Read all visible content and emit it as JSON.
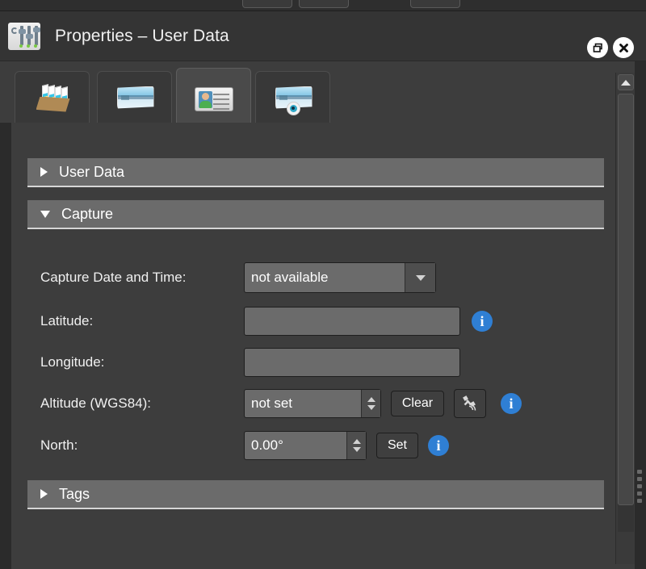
{
  "window": {
    "title": "Properties – User Data",
    "app_icon": "sliders-icon",
    "restore_label": "restore-window",
    "close_label": "close-window"
  },
  "tabs": [
    {
      "name": "tab-images",
      "icon": "image-box-icon",
      "active": false
    },
    {
      "name": "tab-panorama",
      "icon": "panorama-icon",
      "active": false
    },
    {
      "name": "tab-user-data",
      "icon": "id-card-icon",
      "active": true
    },
    {
      "name": "tab-viewer",
      "icon": "panorama-eye-icon",
      "active": false
    }
  ],
  "sections": [
    {
      "label": "User Data",
      "expanded": false,
      "arrow": "triangle-right-icon"
    },
    {
      "label": "Capture",
      "expanded": true,
      "arrow": "triangle-down-icon"
    },
    {
      "label": "Tags",
      "expanded": false,
      "arrow": "triangle-right-icon"
    }
  ],
  "capture": {
    "date_time": {
      "label": "Capture Date and Time:",
      "value": "not available",
      "dropdown_icon": "chevron-down-icon"
    },
    "latitude": {
      "label": "Latitude:",
      "value": "",
      "placeholder": "",
      "info_icon": "info-icon"
    },
    "longitude": {
      "label": "Longitude:",
      "value": "",
      "placeholder": ""
    },
    "altitude": {
      "label": "Altitude (WGS84):",
      "value": "not set",
      "clear_button": "Clear",
      "gps_button_icon": "satellite-icon",
      "info_icon": "info-icon",
      "spinner_icons": [
        "spinner-up-icon",
        "spinner-down-icon"
      ]
    },
    "north": {
      "label": "North:",
      "value": "0.00°",
      "set_button": "Set",
      "info_icon": "info-icon",
      "spinner_icons": [
        "spinner-up-icon",
        "spinner-down-icon"
      ]
    }
  },
  "scrollbar": {
    "up_arrow_icon": "scroll-up-arrow-icon",
    "thumb": "scrollbar-thumb"
  },
  "colors": {
    "panel_bg": "#3d3d3d",
    "titlebar_bg": "#343434",
    "section_header": "#6b6b6b",
    "field_bg": "#6b6b6b",
    "accent_info": "#2f7fd4",
    "text": "#f0f0f0"
  }
}
